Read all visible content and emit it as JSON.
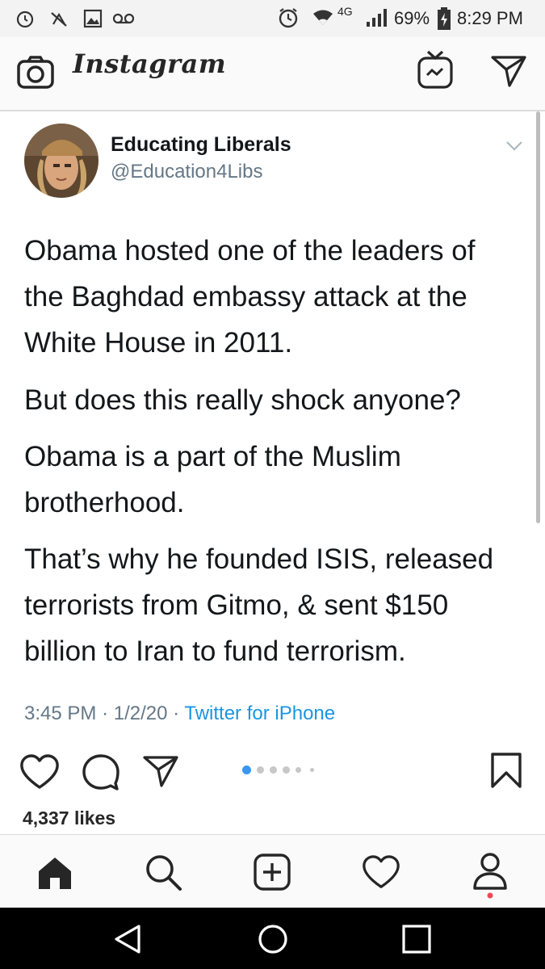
{
  "status_bar": {
    "battery": "69%",
    "time": "8:29 PM",
    "network": "4G"
  },
  "app": {
    "name": "Instagram",
    "icons": [
      "camera-icon",
      "igtv-icon",
      "direct-message-icon"
    ]
  },
  "tweet": {
    "author_name": "Educating Liberals",
    "handle": "@Education4Libs",
    "paragraphs": [
      [
        "Obama hosted one of the leaders of",
        "the Baghdad embassy attack at the",
        "White House in 2011."
      ],
      [
        "But does this really shock anyone?"
      ],
      [
        "Obama is a part of the Muslim",
        "brotherhood."
      ],
      [
        "That’s why he founded ISIS, released",
        "terrorists from Gitmo, & sent $150",
        "billion to Iran to fund terrorism."
      ]
    ],
    "time": "3:45 PM",
    "date": "1/2/20",
    "source": "Twitter for iPhone"
  },
  "post": {
    "likes": "4,337 likes",
    "carousel_dots": 6,
    "active_dot": 0
  },
  "bottom_nav": [
    "home-icon",
    "search-icon",
    "new-post-icon",
    "activity-icon",
    "profile-icon"
  ],
  "colors": {
    "accent_blue": "#1b95e0",
    "carousel_active": "#3897f0",
    "notification_red": "#ed4956"
  }
}
